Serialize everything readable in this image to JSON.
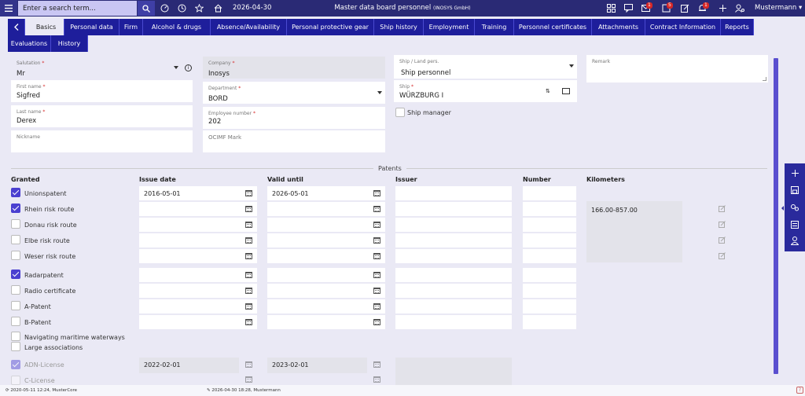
{
  "topbar": {
    "search_placeholder": "Enter a search term...",
    "date": "2026-04-30",
    "title": "Master data board personnel",
    "title_sub": "(INOSYS GmbH)",
    "user": "Mustermann",
    "badges": {
      "mail": "1",
      "alerts": "5",
      "bell": "1"
    }
  },
  "tabs": [
    "Basics",
    "Personal data",
    "Firm",
    "Alcohol & drugs",
    "Absence/Availability",
    "Personal protective gear",
    "Ship history",
    "Employment",
    "Training",
    "Personnel certificates",
    "Attachments",
    "Contract Information",
    "Reports",
    "Evaluations",
    "History"
  ],
  "form": {
    "salutation": {
      "label": "Salutation",
      "value": "Mr"
    },
    "first_name": {
      "label": "First name",
      "value": "Sigfred"
    },
    "last_name": {
      "label": "Last name",
      "value": "Derex"
    },
    "nickname": {
      "label": "Nickname",
      "value": ""
    },
    "company": {
      "label": "Company",
      "value": "Inosys"
    },
    "department": {
      "label": "Department",
      "value": "BORD"
    },
    "employee_number": {
      "label": "Employee number",
      "value": "202"
    },
    "ocimf": {
      "label": "OCIMF Mark",
      "value": ""
    },
    "ship_land": {
      "label": "Ship / Land pers.",
      "value": "Ship personnel"
    },
    "ship": {
      "label": "Ship",
      "value": "WÜRZBURG I"
    },
    "ship_manager": {
      "label": "Ship manager",
      "checked": false
    },
    "remark": {
      "label": "Remark",
      "value": ""
    }
  },
  "patents": {
    "section_title": "Patents",
    "headers": {
      "granted": "Granted",
      "issue": "Issue date",
      "valid": "Valid until",
      "issuer": "Issuer",
      "number": "Number",
      "km": "Kilometers"
    },
    "rows": [
      {
        "label": "Unionspatent",
        "checked": true,
        "issue": "2016-05-01",
        "valid": "2026-05-01",
        "issuer": "",
        "number": ""
      },
      {
        "label": "Rhein risk route",
        "checked": true,
        "issue": "",
        "valid": "",
        "issuer": "",
        "number": "",
        "km": "166.00-857.00"
      },
      {
        "label": "Donau risk route",
        "checked": false,
        "issue": "",
        "valid": "",
        "issuer": "",
        "number": ""
      },
      {
        "label": "Elbe risk route",
        "checked": false,
        "issue": "",
        "valid": "",
        "issuer": "",
        "number": ""
      },
      {
        "label": "Weser risk route",
        "checked": false,
        "issue": "",
        "valid": "",
        "issuer": "",
        "number": ""
      },
      {
        "label": "Radarpatent",
        "checked": true,
        "issue": "",
        "valid": "",
        "issuer": "",
        "number": ""
      },
      {
        "label": "Radio certificate",
        "checked": false,
        "issue": "",
        "valid": "",
        "issuer": "",
        "number": ""
      },
      {
        "label": "A-Patent",
        "checked": false,
        "issue": "",
        "valid": "",
        "issuer": "",
        "number": ""
      },
      {
        "label": "B-Patent",
        "checked": false,
        "issue": "",
        "valid": "",
        "issuer": "",
        "number": ""
      }
    ],
    "navigating": {
      "label": "Navigating maritime waterways",
      "checked": false
    },
    "large_assoc": {
      "label": "Large associations"
    },
    "adn": {
      "label": "ADN-License",
      "checked": true,
      "issue": "2022-02-01",
      "valid": "2023-02-01"
    },
    "c_license": {
      "label": "C-License",
      "checked": false
    }
  },
  "footer": {
    "created": "2020-05-11 12:24, MusterCore",
    "modified": "2026-04-30 18:28, Mustermann"
  }
}
